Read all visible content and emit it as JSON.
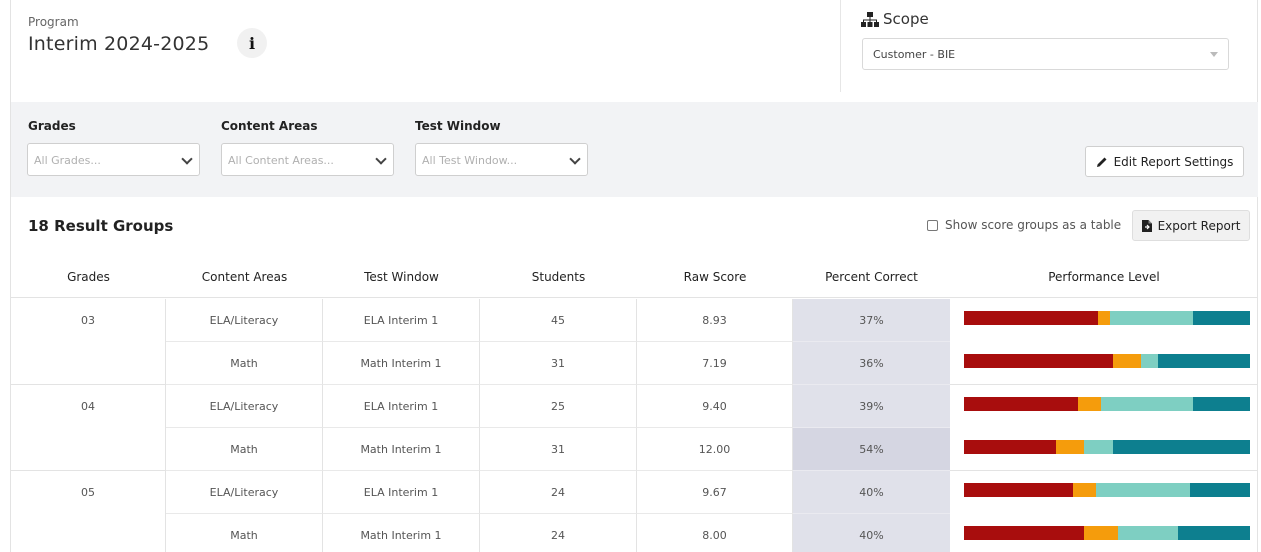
{
  "program": {
    "label": "Program",
    "name": "Interim 2024-2025"
  },
  "scope": {
    "title": "Scope",
    "selected": "Customer - BIE"
  },
  "filters": {
    "grades": {
      "label": "Grades",
      "placeholder": "All Grades..."
    },
    "content_areas": {
      "label": "Content Areas",
      "placeholder": "All Content Areas..."
    },
    "test_window": {
      "label": "Test Window",
      "placeholder": "All Test Window..."
    },
    "edit_button": "Edit Report Settings"
  },
  "results": {
    "title": "18 Result Groups",
    "toggle_label": "Show score groups as a table",
    "export_button": "Export Report"
  },
  "table": {
    "headers": [
      "Grades",
      "Content Areas",
      "Test Window",
      "Students",
      "Raw Score",
      "Percent Correct",
      "Performance Level"
    ],
    "rows": [
      {
        "grade": "03",
        "content": "ELA/Literacy",
        "window": "ELA Interim 1",
        "students": "45",
        "raw": "8.93",
        "pct": "37%",
        "levels": [
          47,
          4,
          29,
          20
        ]
      },
      {
        "grade": "",
        "content": "Math",
        "window": "Math Interim 1",
        "students": "31",
        "raw": "7.19",
        "pct": "36%",
        "levels": [
          52,
          10,
          6,
          32
        ]
      },
      {
        "grade": "04",
        "content": "ELA/Literacy",
        "window": "ELA Interim 1",
        "students": "25",
        "raw": "9.40",
        "pct": "39%",
        "levels": [
          40,
          8,
          32,
          20
        ]
      },
      {
        "grade": "",
        "content": "Math",
        "window": "Math Interim 1",
        "students": "31",
        "raw": "12.00",
        "pct": "54%",
        "levels": [
          32,
          10,
          10,
          48
        ]
      },
      {
        "grade": "05",
        "content": "ELA/Literacy",
        "window": "ELA Interim 1",
        "students": "24",
        "raw": "9.67",
        "pct": "40%",
        "levels": [
          38,
          8,
          33,
          21
        ]
      },
      {
        "grade": "",
        "content": "Math",
        "window": "Math Interim 1",
        "students": "24",
        "raw": "8.00",
        "pct": "40%",
        "levels": [
          42,
          12,
          21,
          25
        ]
      }
    ]
  },
  "colors": {
    "level_1": "#a80d0d",
    "level_2": "#f59c0c",
    "level_3": "#7ecfc2",
    "level_4": "#0d7f8f",
    "percent_bg": "#e0e1ea",
    "percent_bg_alt": "#d5d6e2"
  },
  "icons": {
    "info": "info-icon",
    "scope": "sitemap-icon",
    "edit": "pencil-icon",
    "export": "file-export-icon"
  }
}
